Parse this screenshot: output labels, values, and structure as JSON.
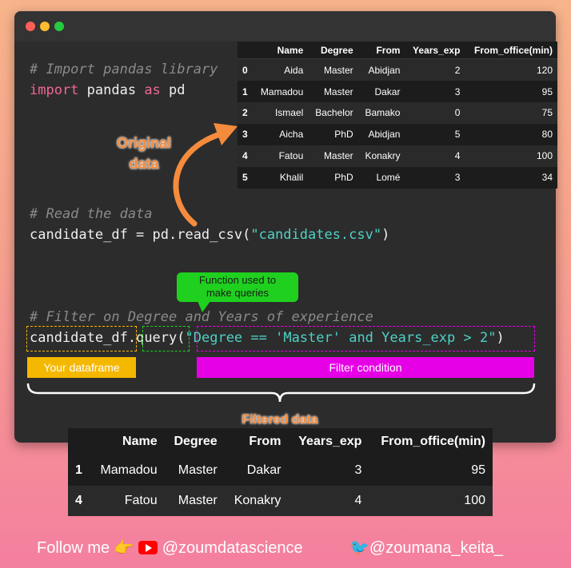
{
  "code": {
    "comment_import": "# Import pandas library",
    "import_kw": "import",
    "import_mod": " pandas ",
    "as_kw": "as",
    "import_alias": " pd",
    "comment_read": "# Read the data",
    "read_prefix": "candidate_df = pd.read_csv(",
    "read_str": "\"candidates.csv\"",
    "read_suffix": ")",
    "comment_filter": "# Filter on Degree and Years of experience",
    "query_df": "candidate_df",
    "query_dot": ".",
    "query_fn": "query",
    "query_open": "(",
    "query_str": "\"Degree == 'Master' and Years_exp > 2\"",
    "query_close": ")"
  },
  "original_table": {
    "headers": [
      "",
      "Name",
      "Degree",
      "From",
      "Years_exp",
      "From_office(min)"
    ],
    "rows": [
      [
        "0",
        "Aida",
        "Master",
        "Abidjan",
        "2",
        "120"
      ],
      [
        "1",
        "Mamadou",
        "Master",
        "Dakar",
        "3",
        "95"
      ],
      [
        "2",
        "Ismael",
        "Bachelor",
        "Bamako",
        "0",
        "75"
      ],
      [
        "3",
        "Aicha",
        "PhD",
        "Abidjan",
        "5",
        "80"
      ],
      [
        "4",
        "Fatou",
        "Master",
        "Konakry",
        "4",
        "100"
      ],
      [
        "5",
        "Khalil",
        "PhD",
        "Lomé",
        "3",
        "34"
      ]
    ]
  },
  "filtered_table": {
    "headers": [
      "",
      "Name",
      "Degree",
      "From",
      "Years_exp",
      "From_office(min)"
    ],
    "rows": [
      [
        "1",
        "Mamadou",
        "Master",
        "Dakar",
        "3",
        "95"
      ],
      [
        "4",
        "Fatou",
        "Master",
        "Konakry",
        "4",
        "100"
      ]
    ]
  },
  "labels": {
    "original_line1": "Original",
    "original_line2": "data",
    "callout_line1": "Function used to",
    "callout_line2": "make queries",
    "your_dataframe": "Your dataframe",
    "filter_condition": "Filter condition",
    "filtered_data": "Filtered data"
  },
  "footer": {
    "follow": "Follow me",
    "youtube_handle": "@zoumdatascience",
    "twitter_handle": "@zoumana_keita_"
  },
  "colors": {
    "orange": "#f58b3c",
    "green": "#1fd01f",
    "yellow": "#f5b800",
    "magenta": "#e600e6"
  }
}
